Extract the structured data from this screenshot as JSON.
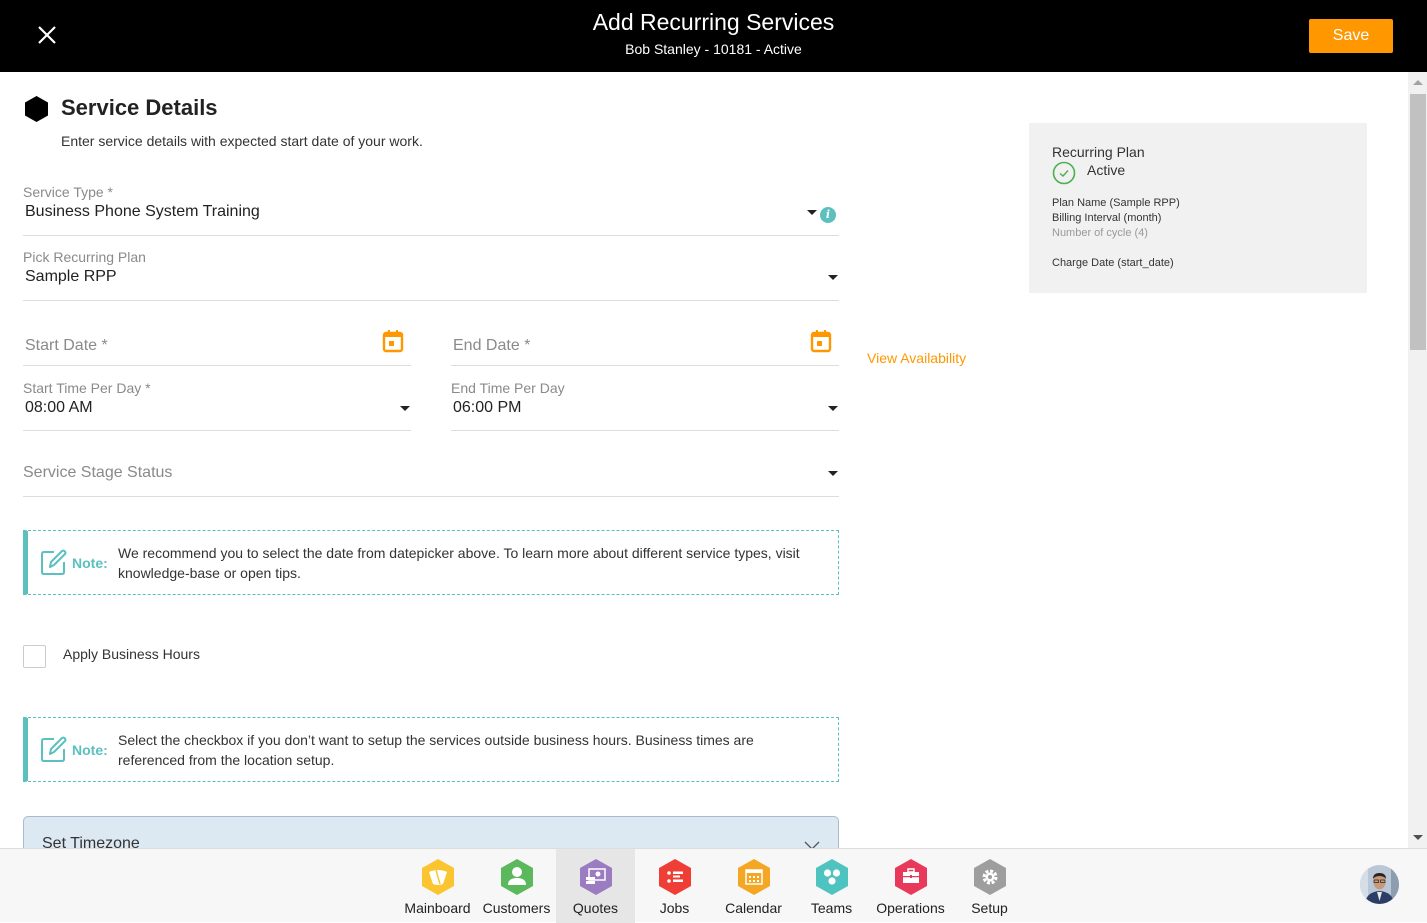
{
  "header": {
    "title": "Add Recurring Services",
    "subtitle": "Bob Stanley - 10181 - Active",
    "save_label": "Save",
    "close_icon": "close-icon"
  },
  "section": {
    "title": "Service Details",
    "description": "Enter service details with expected start date of your work.",
    "icon": "hexagon-icon"
  },
  "form": {
    "service_type": {
      "label": "Service Type *",
      "value": "Business Phone System Training"
    },
    "recurring_plan": {
      "label": "Pick Recurring Plan",
      "value": "Sample RPP"
    },
    "start_date": {
      "placeholder": "Start Date *"
    },
    "end_date": {
      "placeholder": "End Date *"
    },
    "view_availability": "View Availability",
    "start_time": {
      "label": "Start Time Per Day *",
      "value": "08:00 AM"
    },
    "end_time": {
      "label": "End Time Per Day",
      "value": "06:00 PM"
    },
    "stage_status": {
      "placeholder": "Service Stage Status"
    },
    "apply_business_hours": {
      "label": "Apply Business Hours",
      "checked": false
    },
    "timezone": {
      "label": "Set Timezone"
    }
  },
  "notes": [
    {
      "label": "Note:",
      "text": "We recommend you to select the date from datepicker above. To learn more about different service types, visit knowledge-base or open tips."
    },
    {
      "label": "Note:",
      "text": "Select the checkbox if you don’t want to setup the services outside business hours. Business times are referenced from the location setup."
    }
  ],
  "plan_summary": {
    "title": "Recurring Plan",
    "status": "Active",
    "plan_name": "Plan Name (Sample RPP)",
    "billing_interval": "Billing Interval (month)",
    "cycles": "Number of cycle (4)",
    "charge_date": "Charge Date (start_date)"
  },
  "colors": {
    "accent": "#ff9800",
    "note": "#5bc0be",
    "header_bg": "#000000",
    "active_status": "#4caf50"
  },
  "bottom_nav": {
    "active": "Quotes",
    "items": [
      {
        "label": "Mainboard",
        "icon": "mainboard-icon",
        "color": "#fbc531"
      },
      {
        "label": "Customers",
        "icon": "customers-icon",
        "color": "#5cb85c"
      },
      {
        "label": "Quotes",
        "icon": "quotes-icon",
        "color": "#9b7cc1"
      },
      {
        "label": "Jobs",
        "icon": "jobs-icon",
        "color": "#ee3e36"
      },
      {
        "label": "Calendar",
        "icon": "calendar-icon",
        "color": "#f5a623"
      },
      {
        "label": "Teams",
        "icon": "teams-icon",
        "color": "#4fc3c0"
      },
      {
        "label": "Operations",
        "icon": "operations-icon",
        "color": "#e8395a"
      },
      {
        "label": "Setup",
        "icon": "setup-icon",
        "color": "#9e9e9e"
      }
    ]
  }
}
